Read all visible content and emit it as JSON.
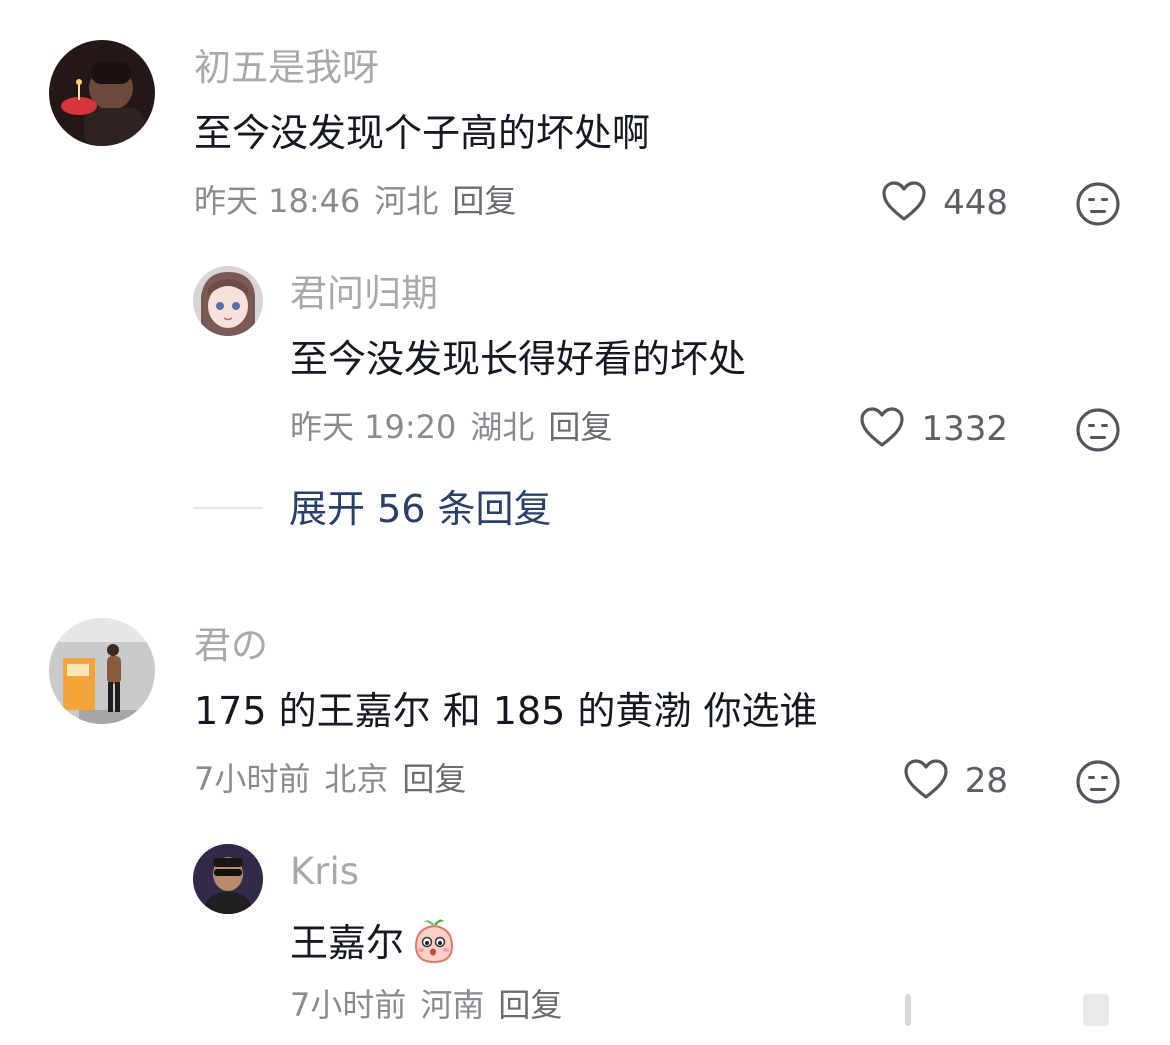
{
  "comments": [
    {
      "username": "初五是我呀",
      "text": "至今没发现个子高的坏处啊",
      "time": "昨天 18:46",
      "location": "河北",
      "reply_label": "回复",
      "likes": "448",
      "replies": [
        {
          "username": "君问归期",
          "text": "至今没发现长得好看的坏处",
          "time": "昨天 19:20",
          "location": "湖北",
          "reply_label": "回复",
          "likes": "1332"
        }
      ],
      "expand_label": "展开 56 条回复"
    },
    {
      "username": "君の",
      "text": "175 的王嘉尔 和 185 的黄渤 你选谁",
      "time": "7小时前",
      "location": "北京",
      "reply_label": "回复",
      "likes": "28",
      "replies": [
        {
          "username": "Kris",
          "text": "王嘉尔",
          "sticker": "peach-sticker-icon",
          "time": "7小时前",
          "location": "河南",
          "reply_label": "回复"
        }
      ]
    }
  ],
  "icons": {
    "like": "heart-outline-icon",
    "dislike": "meh-face-icon"
  },
  "colors": {
    "username": "#a9a9ab",
    "text": "#161823",
    "meta": "#8a8b91",
    "expand": "#2b3f6b"
  }
}
